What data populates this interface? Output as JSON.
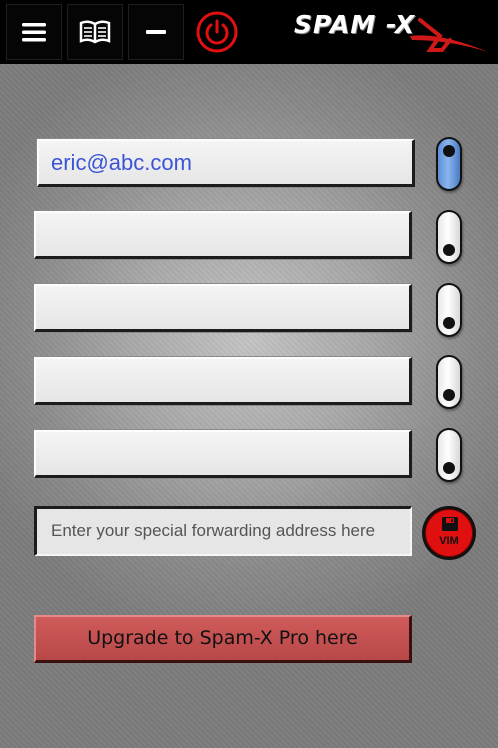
{
  "toolbar": {
    "icons": [
      "menu-icon",
      "book-icon",
      "minimize-icon",
      "power-icon"
    ],
    "power_color": "#e01010"
  },
  "brand": {
    "name": "SPAM -X",
    "accent": "#d01818"
  },
  "emails": [
    {
      "value": "eric@abc.com",
      "enabled": true
    },
    {
      "value": "",
      "enabled": false
    },
    {
      "value": "",
      "enabled": false
    },
    {
      "value": "",
      "enabled": false
    },
    {
      "value": "",
      "enabled": false
    }
  ],
  "forwarding": {
    "placeholder": "Enter your special forwarding address here",
    "value": ""
  },
  "save_button": {
    "label": "VIM",
    "icon": "floppy-disk-icon"
  },
  "upgrade": {
    "label": "Upgrade to Spam-X Pro here"
  }
}
